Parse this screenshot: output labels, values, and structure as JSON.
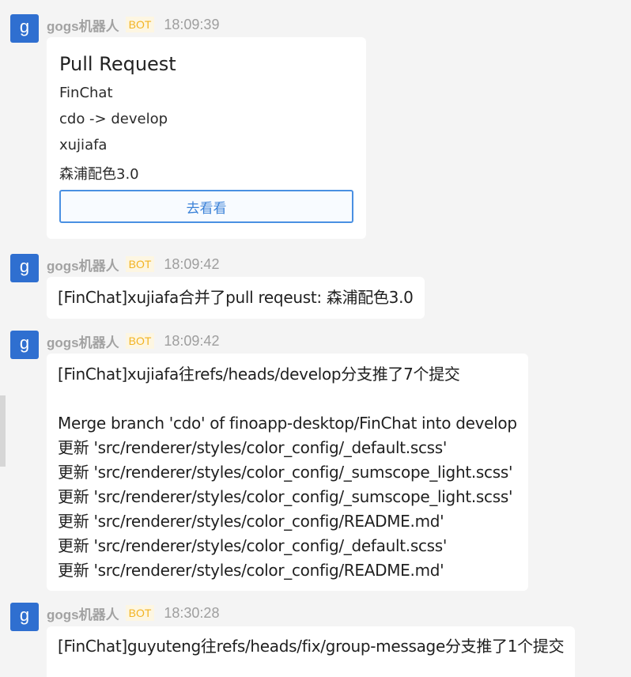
{
  "messages": [
    {
      "avatar_letter": "g",
      "sender": "gogs机器人",
      "badge": "BOT",
      "time": "18:09:39",
      "card": {
        "title": "Pull Request",
        "lines": [
          "FinChat",
          "cdo -> develop",
          "xujiafa",
          "森浦配色3.0"
        ],
        "button_label": "去看看"
      }
    },
    {
      "avatar_letter": "g",
      "sender": "gogs机器人",
      "badge": "BOT",
      "time": "18:09:42",
      "text_lines": [
        "[FinChat]xujiafa合并了pull reqeust: 森浦配色3.0"
      ]
    },
    {
      "avatar_letter": "g",
      "sender": "gogs机器人",
      "badge": "BOT",
      "time": "18:09:42",
      "text_lines": [
        "[FinChat]xujiafa往refs/heads/develop分支推了7个提交",
        "",
        "Merge branch 'cdo' of finoapp-desktop/FinChat into develop",
        "更新 'src/renderer/styles/color_config/_default.scss'",
        "更新 'src/renderer/styles/color_config/_sumscope_light.scss'",
        "更新 'src/renderer/styles/color_config/_sumscope_light.scss'",
        "更新 'src/renderer/styles/color_config/README.md'",
        "更新 'src/renderer/styles/color_config/_default.scss'",
        "更新 'src/renderer/styles/color_config/README.md'"
      ]
    },
    {
      "avatar_letter": "g",
      "sender": "gogs机器人",
      "badge": "BOT",
      "time": "18:30:28",
      "text_lines": [
        "[FinChat]guyuteng往refs/heads/fix/group-message分支推了1个提交"
      ]
    }
  ],
  "colors": {
    "avatar": "#2f6fd0",
    "badge_text": "#f2b321",
    "button_border": "#4a90e2",
    "background": "#f4f4f4"
  }
}
